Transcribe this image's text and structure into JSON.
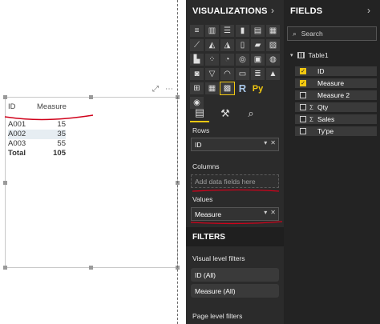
{
  "matrix": {
    "headers": [
      "ID",
      "Measure"
    ],
    "rows": [
      {
        "id": "A001",
        "value": "15"
      },
      {
        "id": "A002",
        "value": "35"
      },
      {
        "id": "A003",
        "value": "55"
      }
    ],
    "total": {
      "label": "Total",
      "value": "105"
    }
  },
  "visualizations": {
    "title": "VISUALIZATIONS",
    "icons": [
      "stacked-bar-icon",
      "stacked-column-icon",
      "clustered-bar-icon",
      "clustered-column-icon",
      "100-bar-icon",
      "100-column-icon",
      "line-chart-icon",
      "area-chart-icon",
      "stacked-area-icon",
      "line-column-icon",
      "line-clustered-icon",
      "ribbon-chart-icon",
      "waterfall-icon",
      "scatter-icon",
      "pie-chart-icon",
      "donut-icon",
      "treemap-icon",
      "map-icon",
      "filled-map-icon",
      "funnel-icon",
      "gauge-icon",
      "card-icon",
      "multirow-card-icon",
      "kpi-icon",
      "slicer-icon",
      "table-icon",
      "matrix-icon",
      "r-visual-icon",
      "python-visual-icon",
      "",
      "arcgis-icon"
    ],
    "r_label": "R",
    "py_label": "Py",
    "rows_label": "Rows",
    "rows_field": "ID",
    "columns_label": "Columns",
    "columns_placeholder": "Add data fields here",
    "values_label": "Values",
    "values_field": "Measure"
  },
  "filters": {
    "title": "FILTERS",
    "visual_level_label": "Visual level filters",
    "visual_filters": [
      "ID (All)",
      "Measure  (All)"
    ],
    "page_level_label": "Page level filters"
  },
  "fields": {
    "title": "FIELDS",
    "search_placeholder": "Search",
    "table_name": "Table1",
    "items": [
      {
        "label": "ID",
        "checked": true,
        "sigma": false
      },
      {
        "label": "Measure",
        "checked": true,
        "sigma": false
      },
      {
        "label": "Measure 2",
        "checked": false,
        "sigma": false
      },
      {
        "label": "Qty",
        "checked": false,
        "sigma": true
      },
      {
        "label": "Sales",
        "checked": false,
        "sigma": true
      },
      {
        "label": "Ty'pe",
        "checked": false,
        "sigma": false
      }
    ]
  },
  "colors": {
    "accent": "#f2c811",
    "pane_dark": "#2b2b2b",
    "annotation_red": "#d0021b"
  }
}
